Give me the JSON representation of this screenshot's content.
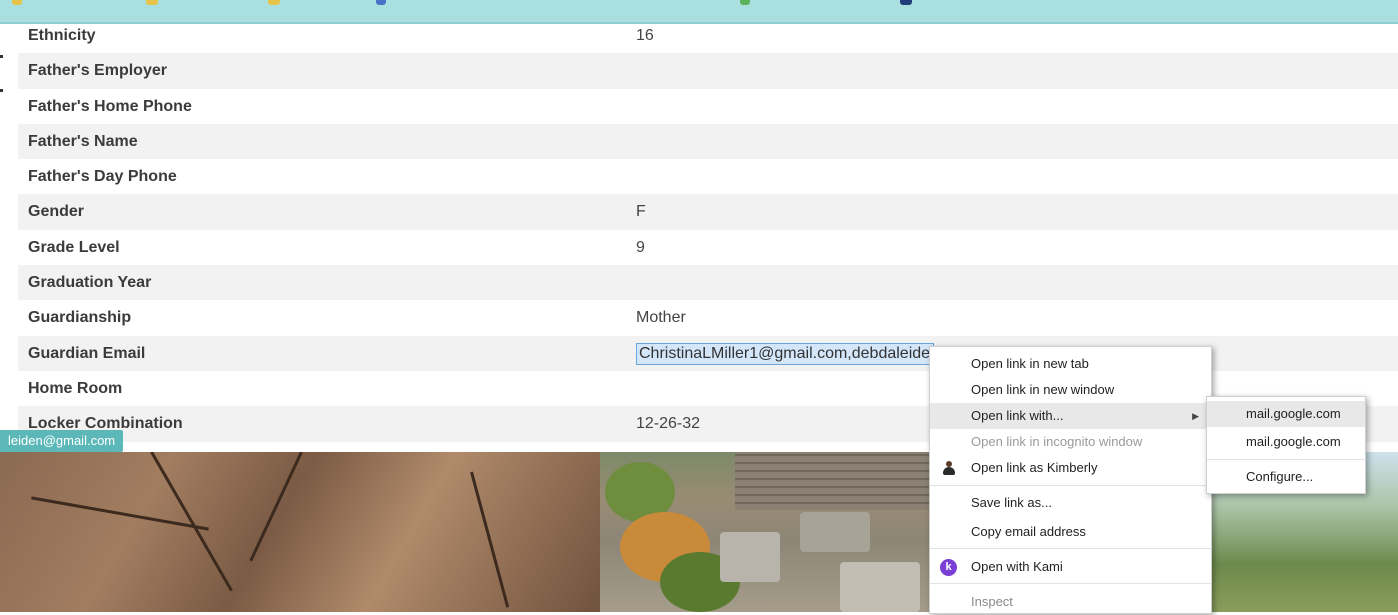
{
  "fields": [
    {
      "label": "Ethnicity",
      "value": "16"
    },
    {
      "label": "Father's Employer",
      "value": ""
    },
    {
      "label": "Father's Home Phone",
      "value": ""
    },
    {
      "label": "Father's Name",
      "value": ""
    },
    {
      "label": "Father's Day Phone",
      "value": ""
    },
    {
      "label": "Gender",
      "value": "F"
    },
    {
      "label": "Grade Level",
      "value": "9"
    },
    {
      "label": "Graduation Year",
      "value": ""
    },
    {
      "label": "Guardianship",
      "value": "Mother"
    },
    {
      "label": "Guardian Email",
      "value": "ChristinaLMiller1@gmail.com,debdaleiden@gmail.com"
    },
    {
      "label": "Home Room",
      "value": ""
    },
    {
      "label": "Locker Combination",
      "value": "12-26-32"
    }
  ],
  "link_tooltip": "leiden@gmail.com",
  "context_menu": {
    "open_new_tab": "Open link in new tab",
    "open_new_window": "Open link in new window",
    "open_with": "Open link with...",
    "open_incognito": "Open link in incognito window",
    "open_as_profile": "Open link as Kimberly",
    "save_link": "Save link as...",
    "copy_email": "Copy email address",
    "open_kami": "Open with Kami",
    "inspect": "Inspect"
  },
  "submenu": {
    "items": [
      "mail.google.com",
      "mail.google.com"
    ],
    "configure": "Configure..."
  },
  "icons": {
    "submenu_arrow": "chevron-right-icon",
    "profile": "user-avatar-icon",
    "kami": "kami-logo-icon"
  },
  "colors": {
    "topbar": "#aadfe0",
    "tooltip": "#5cb8b8",
    "selection": "#d4e7fa",
    "kami": "#7b3fd6"
  }
}
